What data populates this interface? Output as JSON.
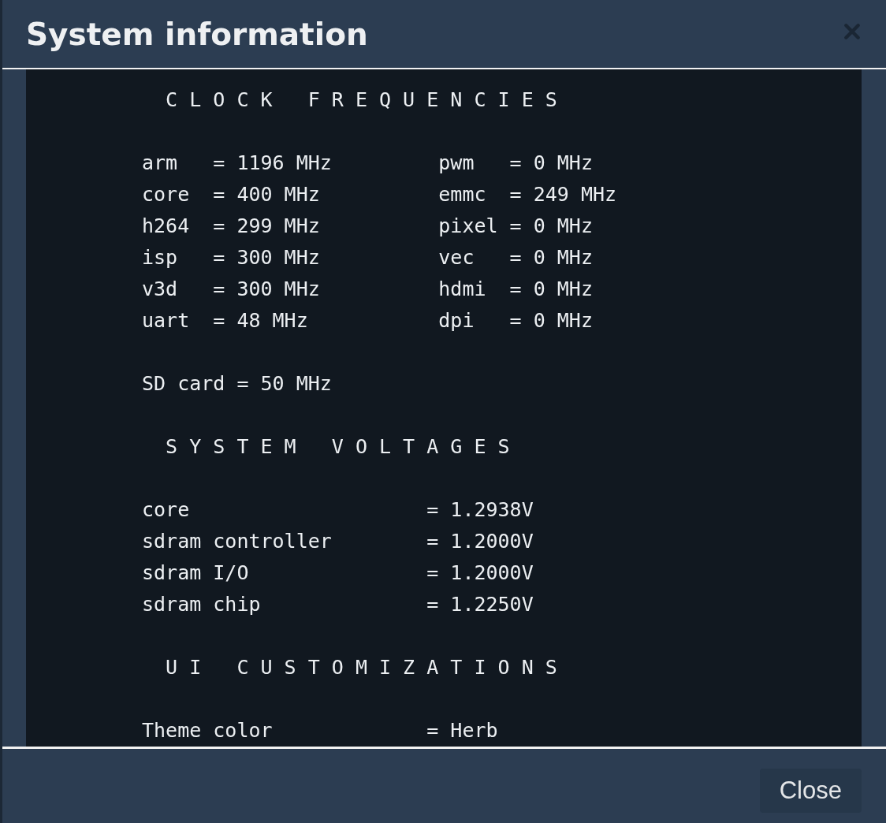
{
  "dialog": {
    "title": "System information",
    "close_button": "Close"
  },
  "console": {
    "sections": [
      {
        "heading": "C L O C K   F R E Q U E N C I E S",
        "groups": [
          {
            "kind": "pairs",
            "rows": [
              [
                "arm   = 1196 MHz",
                "pwm   = 0 MHz"
              ],
              [
                "core  = 400 MHz",
                "emmc  = 249 MHz"
              ],
              [
                "h264  = 299 MHz",
                "pixel = 0 MHz"
              ],
              [
                "isp   = 300 MHz",
                "vec   = 0 MHz"
              ],
              [
                "v3d   = 300 MHz",
                "hdmi  = 0 MHz"
              ],
              [
                "uart  = 48 MHz",
                "dpi   = 0 MHz"
              ]
            ]
          },
          {
            "kind": "lines",
            "rows": [
              "SD card = 50 MHz"
            ]
          }
        ]
      },
      {
        "heading": "S Y S T E M   V O L T A G E S",
        "groups": [
          {
            "kind": "lines",
            "rows": [
              "core                    = 1.2938V",
              "sdram controller        = 1.2000V",
              "sdram I/O               = 1.2000V",
              "sdram chip              = 1.2250V"
            ]
          }
        ]
      },
      {
        "heading": "U I   C U S T O M I Z A T I O N S",
        "groups": [
          {
            "kind": "lines",
            "rows": [
              "Theme color             = Herb"
            ]
          }
        ]
      }
    ]
  }
}
